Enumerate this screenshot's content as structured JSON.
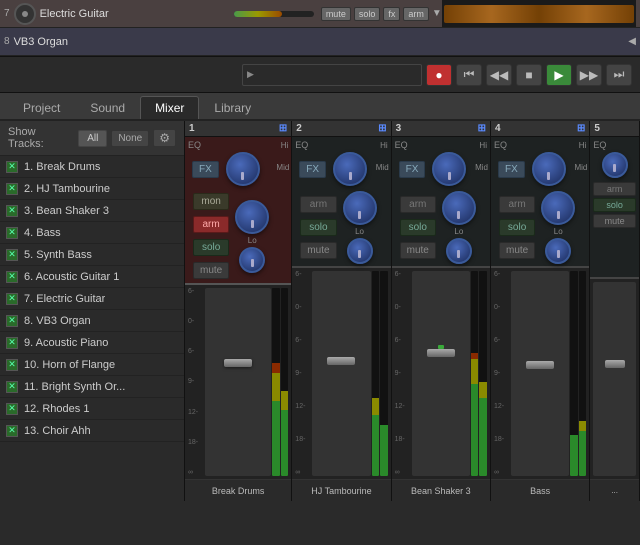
{
  "tracks": {
    "electric_guitar": {
      "name": "Electric Guitar",
      "row_num": "7"
    },
    "vb3_organ": {
      "name": "VB3 Organ",
      "row_num": "8"
    }
  },
  "transport": {
    "buttons": [
      "●",
      "⏮",
      "◀◀",
      "■",
      "▶▶",
      "⏭"
    ]
  },
  "tabs": {
    "items": [
      "Project",
      "Sound",
      "Mixer",
      "Library"
    ],
    "active": "Mixer"
  },
  "show_tracks": {
    "label": "Show Tracks:",
    "all": "All",
    "none": "None"
  },
  "track_list": [
    {
      "num": "1.",
      "name": "Break Drums"
    },
    {
      "num": "2.",
      "name": "HJ Tambourine"
    },
    {
      "num": "3.",
      "name": "Bean Shaker 3"
    },
    {
      "num": "4.",
      "name": "Bass"
    },
    {
      "num": "5.",
      "name": "Synth Bass"
    },
    {
      "num": "6.",
      "name": "Acoustic Guitar 1"
    },
    {
      "num": "7.",
      "name": "Electric Guitar"
    },
    {
      "num": "8.",
      "name": "VB3 Organ"
    },
    {
      "num": "9.",
      "name": "Acoustic Piano"
    },
    {
      "num": "10.",
      "name": "Horn of Flange"
    },
    {
      "num": "11.",
      "name": "Bright Synth Or..."
    },
    {
      "num": "12.",
      "name": "Rhodes 1"
    },
    {
      "num": "13.",
      "name": "Choir Ahh"
    }
  ],
  "channels": [
    {
      "num": "1",
      "name": "Break Drums",
      "armed": true
    },
    {
      "num": "2",
      "name": "HJ Tambourine",
      "armed": false
    },
    {
      "num": "3",
      "name": "Bean Shaker 3",
      "armed": false
    },
    {
      "num": "4",
      "name": "Bass",
      "armed": false
    },
    {
      "num": "5",
      "name": "...",
      "armed": false
    }
  ],
  "fader_scale": [
    "6-",
    "0-",
    "6-",
    "9-",
    "12-",
    "18-",
    "∞"
  ],
  "buttons": {
    "fx": "FX",
    "arm": "arm",
    "solo": "solo",
    "mute": "mute",
    "mon": "mon"
  },
  "knob_labels": {
    "eq": "EQ",
    "hi": "Hi",
    "mid": "Mid",
    "lo": "Lo"
  }
}
